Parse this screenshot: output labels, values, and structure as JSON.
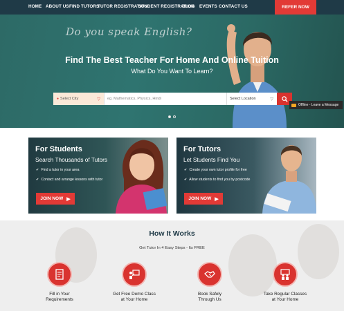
{
  "nav": {
    "items": [
      "HOME",
      "ABOUT US",
      "FIND TUTORS",
      "TUTOR REGISTRATION",
      "STUDENT REGISTRATION",
      "BLOG",
      "EVENTS",
      "CONTACT US"
    ],
    "refer_label": "REFER NOW"
  },
  "hero": {
    "board_text": "Do you speak English?",
    "title": "Find The Best Teacher For Home And Online Tuition",
    "subtitle": "What Do You Want To Learn?",
    "search": {
      "city_label": "Select City",
      "subject_placeholder": "eg. Mathematics, Physics, Hindi",
      "location_label": "Select Location"
    },
    "offline_label": "Offline - Leave a Message"
  },
  "students_card": {
    "title": "For Students",
    "subtitle": "Search Thousands of Tutors",
    "points": [
      "Find a tutor in your area",
      "Contact and arrange lessons with tutor"
    ],
    "button": "JOIN NOW"
  },
  "tutors_card": {
    "title": "For Tutors",
    "subtitle": "Let Students Find You",
    "points": [
      "Create your own tutor profile for free",
      "Allow students to find you by postcode"
    ],
    "button": "JOIN NOW"
  },
  "how": {
    "title": "How It Works",
    "subtitle": "Get Tutor In 4 Easy Steps - Its FREE",
    "steps": [
      {
        "line1": "Fill in Your",
        "line2": "Requirements",
        "icon": "form-icon"
      },
      {
        "line1": "Get Free Demo Class",
        "line2": "at Your Home",
        "icon": "presentation-icon"
      },
      {
        "line1": "Book Safely",
        "line2": "Through Us",
        "icon": "handshake-icon"
      },
      {
        "line1": "Take Regular Classes",
        "line2": "at Your Home",
        "icon": "teaching-icon"
      }
    ]
  },
  "colors": {
    "nav": "#1f3a47",
    "accent": "#e23a36",
    "hero": "#2f7470"
  }
}
